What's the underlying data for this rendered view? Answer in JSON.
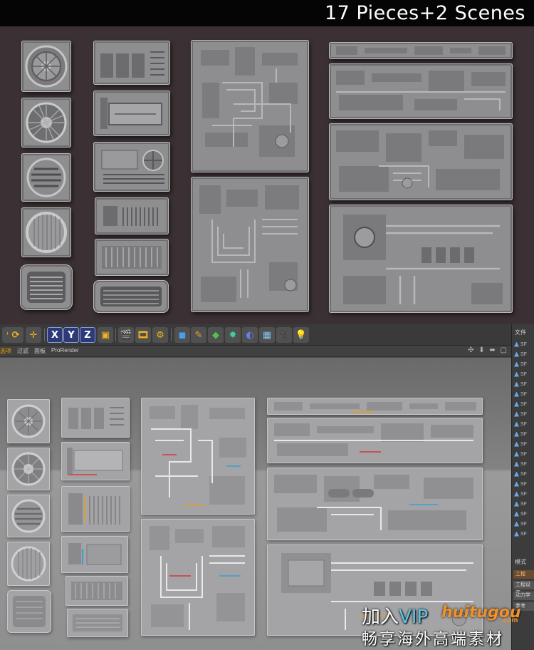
{
  "banner": {
    "title": "17 Pieces+2 Scenes"
  },
  "toolbar": {
    "axis_x": "X",
    "axis_y": "Y",
    "axis_z": "Z"
  },
  "menubar": {
    "items": [
      "选项",
      "过滤",
      "面板",
      "ProRender"
    ],
    "view_controls": "✣ ⬇ ⬌ ▢"
  },
  "sidebar": {
    "header": "文件",
    "objects": [
      "SF",
      "SF",
      "SF",
      "SF",
      "SF",
      "SF",
      "SF",
      "SF",
      "SF",
      "SF",
      "SF",
      "SF",
      "SF",
      "SF",
      "SF",
      "SF",
      "SF",
      "SF",
      "SF",
      "SF"
    ],
    "attr_title": "模式",
    "attr_tags": [
      "工程",
      "工程设置",
      "动力学",
      "参考"
    ]
  },
  "watermark": {
    "join": "加入",
    "vip": "VIP",
    "domain": "huitugou",
    "tld": ".com",
    "slogan": "畅享海外高端素材"
  },
  "colors": {
    "banner_bg": "#050505",
    "showcase_bg": "#3b3134",
    "viewport_bg": "#838383",
    "watermark_vip": "#59c6e8",
    "watermark_domain": "#f19128"
  }
}
